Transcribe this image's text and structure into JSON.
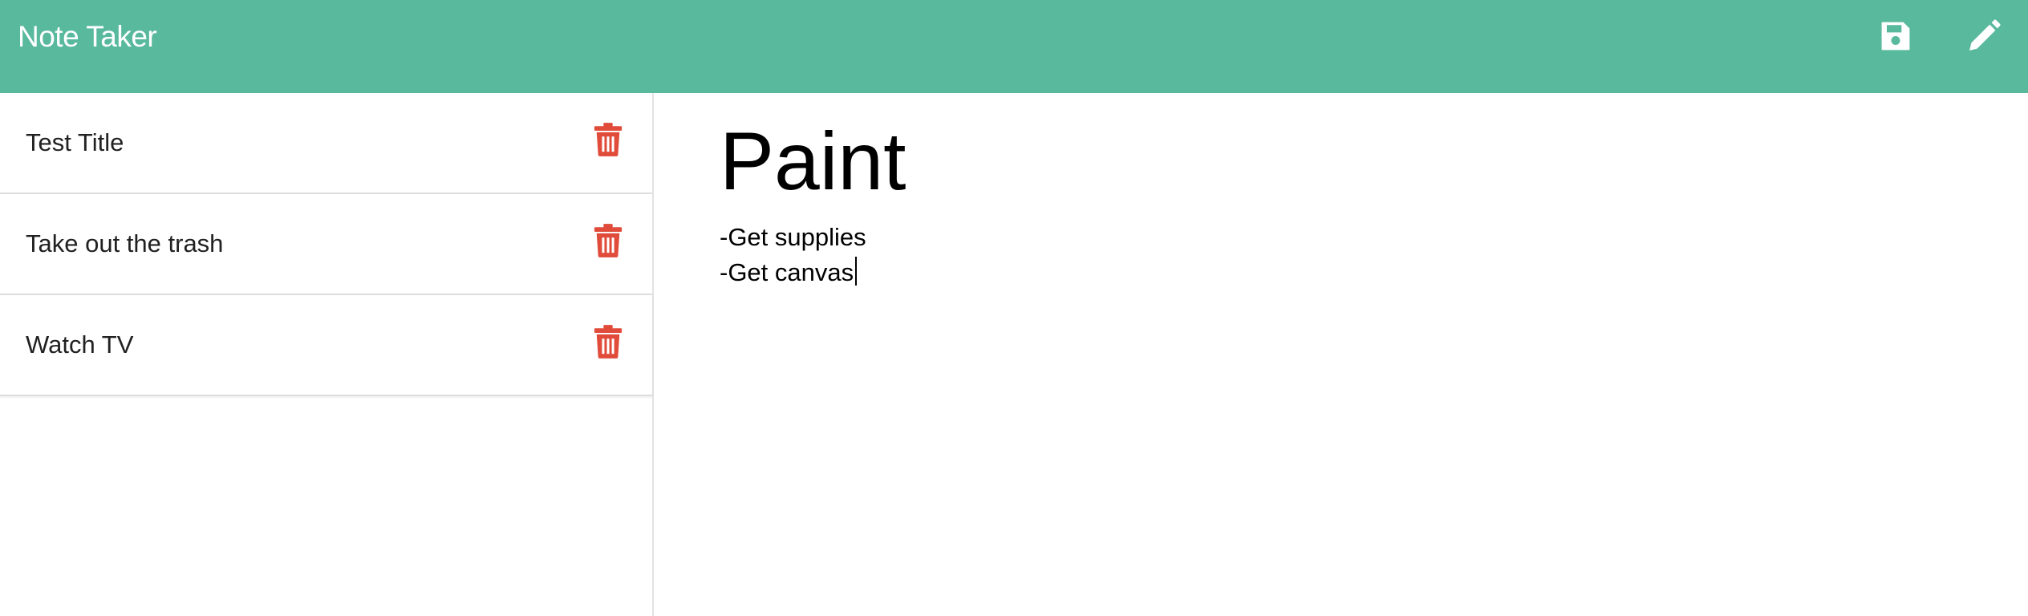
{
  "app": {
    "brand": "Note Taker"
  },
  "toolbar": {
    "save_icon": "floppy-disk-icon",
    "edit_icon": "pencil-icon",
    "icon_color": "#ffffff"
  },
  "colors": {
    "accent": "#59b99d",
    "delete": "#e04b3a"
  },
  "notes": [
    {
      "title": "Test Title",
      "delete_icon": "trash-icon"
    },
    {
      "title": "Take out the trash",
      "delete_icon": "trash-icon"
    },
    {
      "title": "Watch TV",
      "delete_icon": "trash-icon"
    }
  ],
  "editor": {
    "title_value": "Paint",
    "body_line1": "-Get supplies",
    "body_line2": "-Get canvas"
  }
}
